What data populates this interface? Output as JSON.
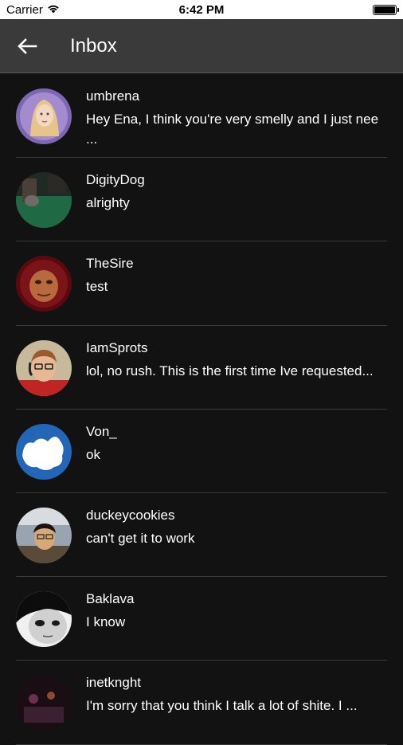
{
  "status_bar": {
    "carrier": "Carrier",
    "time": "6:42 PM"
  },
  "header": {
    "title": "Inbox"
  },
  "conversations": [
    {
      "name": "umbrena",
      "message": "Hey Ena, I think you're very smelly and I just nee ..."
    },
    {
      "name": "DigityDog",
      "message": "alrighty"
    },
    {
      "name": "TheSire",
      "message": "test"
    },
    {
      "name": "IamSprots",
      "message": "lol, no rush. This is the first time Ive requested..."
    },
    {
      "name": "Von_",
      "message": "ok"
    },
    {
      "name": "duckeycookies",
      "message": "can't get it to work"
    },
    {
      "name": "Baklava",
      "message": "I know"
    },
    {
      "name": "inetknght",
      "message": "I'm sorry that you think I talk a lot of shite. I ..."
    }
  ],
  "colors": {
    "background": "#121212",
    "app_bar": "#3a3a3a",
    "divider": "#3a3a3a",
    "text": "#ffffff"
  }
}
